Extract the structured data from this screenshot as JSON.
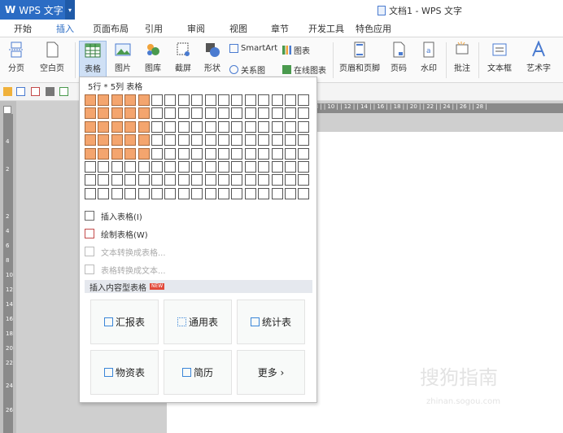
{
  "app": {
    "logo": "W",
    "name": "WPS 文字",
    "caret": "▾"
  },
  "window_title": "文档1 - WPS 文字",
  "tabs": [
    "开始",
    "插入",
    "页面布局",
    "引用",
    "审阅",
    "视图",
    "章节",
    "开发工具",
    "特色应用"
  ],
  "active_tab": "插入",
  "ribbon": {
    "page_break": "分页",
    "blank_page": "空白页",
    "table": "表格",
    "picture": "图片",
    "gallery": "图库",
    "screenshot": "截屏",
    "shape": "形状",
    "smartart": "SmartArt",
    "chart": "图表",
    "relation": "关系图",
    "online_chart": "在线图表",
    "header_footer": "页眉和页脚",
    "page_number": "页码",
    "watermark": "水印",
    "comment": "批注",
    "textbox": "文本框",
    "wordart": "艺术字"
  },
  "dropdown": {
    "grid_label": "5行 * 5列 表格",
    "insert_table": "插入表格(I)",
    "draw_table": "绘制表格(W)",
    "text_to_table": "文本转换成表格...",
    "table_to_text": "表格转换成文本...",
    "section_title": "插入内容型表格",
    "new_badge": "NEW",
    "tiles": [
      "汇报表",
      "通用表",
      "统计表",
      "物资表",
      "简历",
      "更多 ›"
    ]
  },
  "hruler_text": "| 8 |  | 10 |  | 12 |  | 14 |  | 16 |  | 18 |  | 20 |  | 22 |  | 24 |  | 26 |  | 28 |",
  "vruler_labels": [
    "4",
    "2",
    "2",
    "4",
    "6",
    "8",
    "10",
    "12",
    "14",
    "16",
    "18",
    "20",
    "22",
    "24",
    "26"
  ],
  "watermark": "搜狗指南",
  "watermark_url": "zhinan.sogou.com",
  "colors": {
    "accent": "#2b6cc4",
    "grid_selected": "#f4a56e"
  }
}
